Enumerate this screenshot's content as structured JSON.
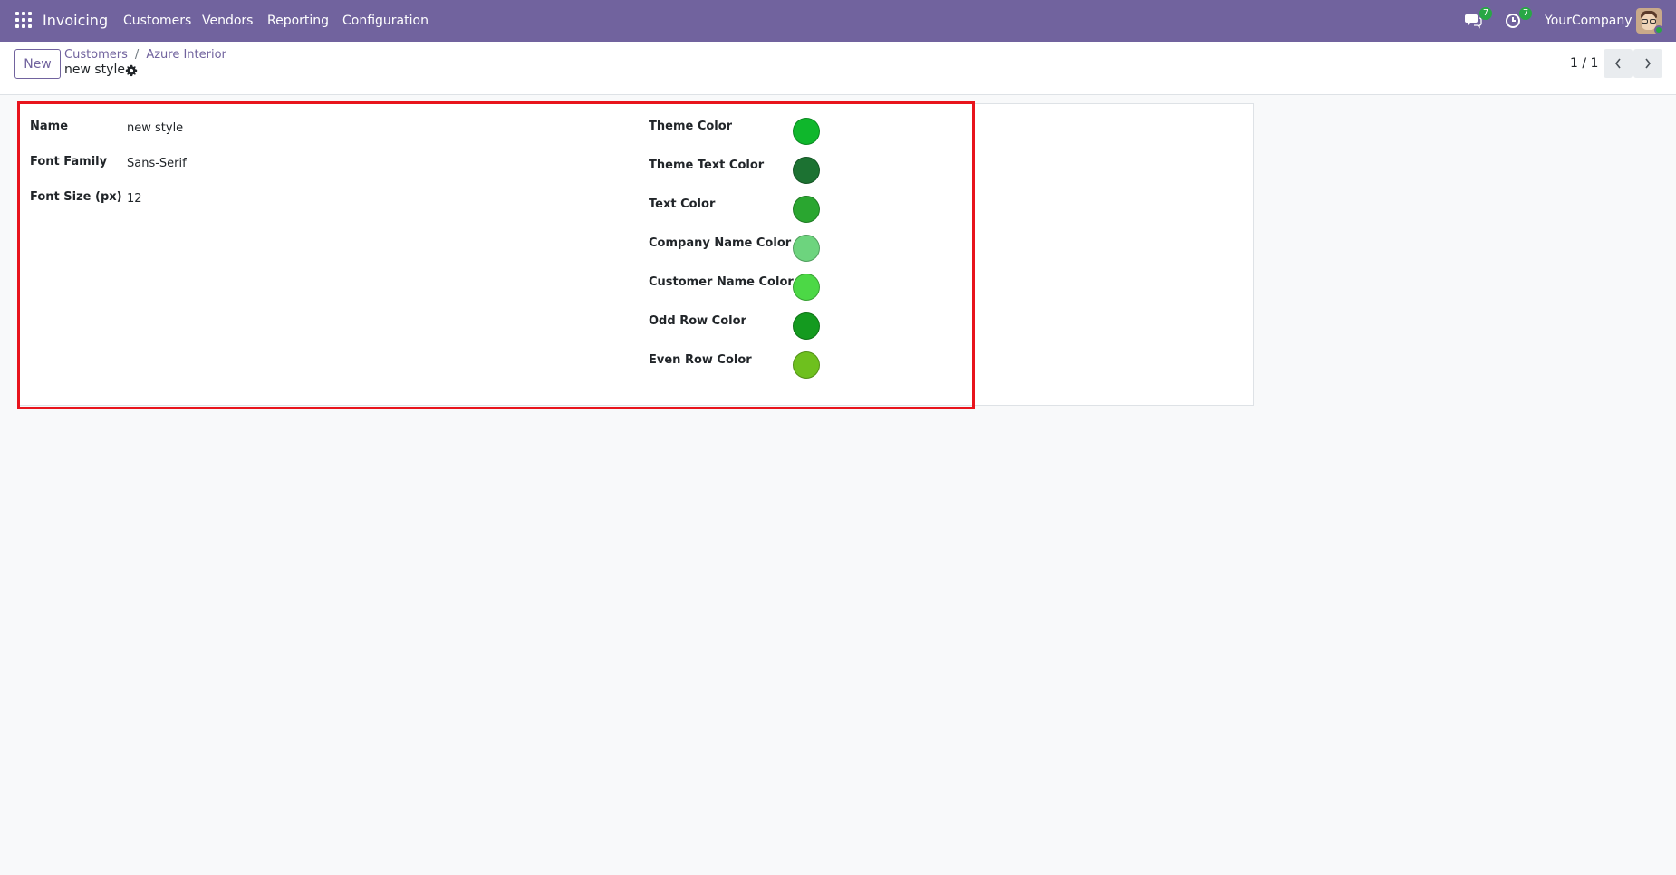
{
  "navbar": {
    "app_name": "Invoicing",
    "menu": [
      "Customers",
      "Vendors",
      "Reporting",
      "Configuration"
    ],
    "messages_count": "7",
    "activities_count": "7",
    "company": "YourCompany"
  },
  "control_panel": {
    "new_label": "New",
    "breadcrumb": [
      "Customers",
      "Azure Interior"
    ],
    "breadcrumb_separator": "/",
    "record_title": "new style",
    "pager": "1 / 1"
  },
  "form": {
    "name_label": "Name",
    "name_value": "new style",
    "font_family_label": "Font Family",
    "font_family_value": "Sans-Serif",
    "font_size_label": "Font Size (px)",
    "font_size_value": "12",
    "colors": [
      {
        "label": "Theme Color",
        "color": "#0fb72c"
      },
      {
        "label": "Theme Text Color",
        "color": "#1c7232"
      },
      {
        "label": "Text Color",
        "color": "#2aa630"
      },
      {
        "label": "Company Name Color",
        "color": "#6dd47e"
      },
      {
        "label": "Customer Name Color",
        "color": "#4cd846"
      },
      {
        "label": "Odd Row Color",
        "color": "#149a1f"
      },
      {
        "label": "Even Row Color",
        "color": "#6ec01e"
      }
    ]
  }
}
